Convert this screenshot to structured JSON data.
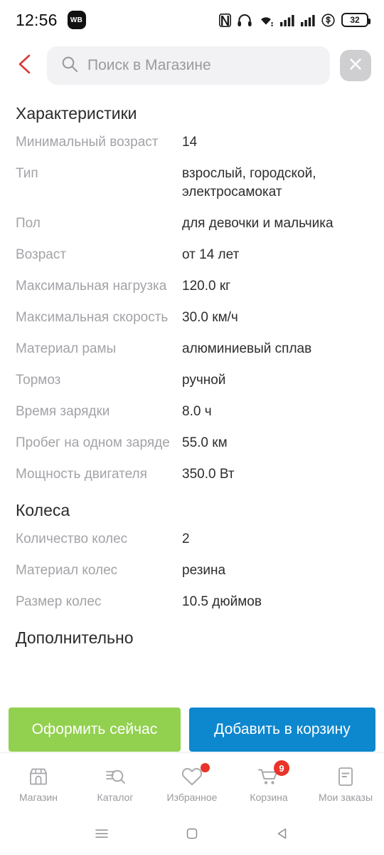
{
  "status_bar": {
    "time": "12:56",
    "app_badge": "WB",
    "icons": [
      "nfc-icon",
      "headphones-icon",
      "wifi-icon",
      "signal-icon",
      "signal-icon",
      "shield-dollar-icon"
    ],
    "battery_percent": "32"
  },
  "header": {
    "back_icon": "back-chevron-icon",
    "back_color": "#d93a3a",
    "search_icon": "search-icon",
    "search_placeholder": "Поиск в Магазине",
    "search_value": "",
    "close_icon": "close-icon"
  },
  "sections": [
    {
      "title": "Характеристики",
      "rows": [
        {
          "label": "Минимальный возраст",
          "value": "14"
        },
        {
          "label": "Тип",
          "value": "взрослый, городской, электросамокат"
        },
        {
          "label": "Пол",
          "value": "для девочки и мальчика"
        },
        {
          "label": "Возраст",
          "value": "от 14 лет"
        },
        {
          "label": "Максимальная нагрузка",
          "value": "120.0 кг"
        },
        {
          "label": "Максимальная скорость",
          "value": "30.0 км/ч"
        },
        {
          "label": "Материал рамы",
          "value": "алюминиевый сплав"
        },
        {
          "label": "Тормоз",
          "value": "ручной"
        },
        {
          "label": "Время зарядки",
          "value": "8.0 ч"
        },
        {
          "label": "Пробег на одном заряде",
          "value": "55.0 км"
        },
        {
          "label": "Мощность двигателя",
          "value": "350.0 Вт"
        }
      ]
    },
    {
      "title": "Колеса",
      "rows": [
        {
          "label": "Количество колес",
          "value": "2"
        },
        {
          "label": "Материал колес",
          "value": "резина"
        },
        {
          "label": "Размер колес",
          "value": "10.5 дюймов"
        }
      ]
    },
    {
      "title": "Дополнительно",
      "rows": []
    }
  ],
  "actions": {
    "order_now_label": "Оформить сейчас",
    "order_now_color": "#92d04f",
    "add_to_cart_label": "Добавить в корзину",
    "add_to_cart_color": "#0d87ce"
  },
  "tabbar": [
    {
      "label": "Магазин",
      "icon": "store-icon",
      "badge": ""
    },
    {
      "label": "Каталог",
      "icon": "catalog-icon",
      "badge": ""
    },
    {
      "label": "Избранное",
      "icon": "heart-icon",
      "badge": "dot"
    },
    {
      "label": "Корзина",
      "icon": "cart-icon",
      "badge": "9"
    },
    {
      "label": "Мои заказы",
      "icon": "orders-icon",
      "badge": ""
    }
  ],
  "system_nav": {
    "recents_icon": "recents-icon",
    "home_icon": "home-square-icon",
    "back_icon": "back-triangle-icon"
  }
}
